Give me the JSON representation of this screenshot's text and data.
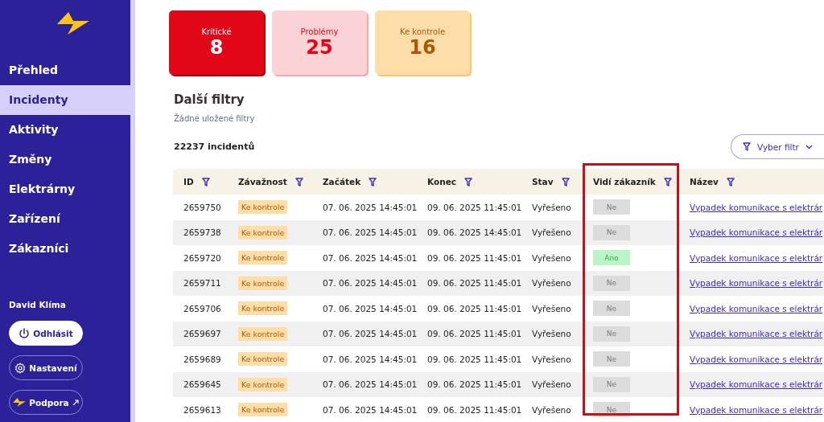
{
  "sidebar": {
    "items": [
      {
        "label": "Přehled",
        "selected": false
      },
      {
        "label": "Incidenty",
        "selected": true
      },
      {
        "label": "Aktivity",
        "selected": false
      },
      {
        "label": "Změny",
        "selected": false
      },
      {
        "label": "Elektrárny",
        "selected": false
      },
      {
        "label": "Zařízení",
        "selected": false
      },
      {
        "label": "Zákazníci",
        "selected": false
      }
    ],
    "user": "David Klíma",
    "buttons": [
      {
        "kind": "logout",
        "label": "Odhlásit"
      },
      {
        "kind": "settings",
        "label": "Nastavení"
      },
      {
        "kind": "support",
        "label": "Podpora"
      }
    ]
  },
  "summary_cards": [
    {
      "kind": "critical",
      "label": "Kritické",
      "count": "8"
    },
    {
      "kind": "problem",
      "label": "Problémy",
      "count": "25"
    },
    {
      "kind": "review",
      "label": "Ke kontrole",
      "count": "16"
    }
  ],
  "filters": {
    "title": "Další filtry",
    "empty_text": "Žádné uložené filtry",
    "select_button": "Vyber filtr"
  },
  "incident_count": "22237 incidentů",
  "table": {
    "columns": [
      {
        "label": "ID",
        "highlighted": false
      },
      {
        "label": "Závažnost",
        "highlighted": false
      },
      {
        "label": "Začátek",
        "highlighted": false
      },
      {
        "label": "Konec",
        "highlighted": false
      },
      {
        "label": "Stav",
        "highlighted": false
      },
      {
        "label": "Vidí zákazník",
        "highlighted": true
      },
      {
        "label": "Název",
        "highlighted": false
      }
    ],
    "rows": [
      {
        "id": "2659750",
        "severity": "Ke kontrole",
        "start": "07. 06. 2025 14:45:01",
        "end": "09. 06. 2025 11:45:01",
        "status": "Vyřešeno",
        "customer_visible": false,
        "visible_label": "Ne",
        "name": "Vypadek komunikace s elektrár"
      },
      {
        "id": "2659738",
        "severity": "Ke kontrole",
        "start": "07. 06. 2025 14:45:01",
        "end": "09. 06. 2025 14:45:01",
        "status": "Vyřešeno",
        "customer_visible": false,
        "visible_label": "Ne",
        "name": "Vypadek komunikace s elektrár"
      },
      {
        "id": "2659720",
        "severity": "Ke kontrole",
        "start": "07. 06. 2025 14:45:01",
        "end": "09. 06. 2025 11:45:01",
        "status": "Vyřešeno",
        "customer_visible": true,
        "visible_label": "Ano",
        "name": "Vypadek komunikace s elektrár"
      },
      {
        "id": "2659711",
        "severity": "Ke kontrole",
        "start": "07. 06. 2025 14:45:01",
        "end": "09. 06. 2025 11:45:01",
        "status": "Vyřešeno",
        "customer_visible": false,
        "visible_label": "Ne",
        "name": "Vypadek komunikace s elektrár"
      },
      {
        "id": "2659706",
        "severity": "Ke kontrole",
        "start": "07. 06. 2025 14:45:01",
        "end": "09. 06. 2025 11:45:01",
        "status": "Vyřešeno",
        "customer_visible": false,
        "visible_label": "Ne",
        "name": "Vypadek komunikace s elektrár"
      },
      {
        "id": "2659697",
        "severity": "Ke kontrole",
        "start": "07. 06. 2025 14:45:01",
        "end": "09. 06. 2025 11:45:01",
        "status": "Vyřešeno",
        "customer_visible": false,
        "visible_label": "Ne",
        "name": "Vypadek komunikace s elektrár"
      },
      {
        "id": "2659689",
        "severity": "Ke kontrole",
        "start": "07. 06. 2025 14:45:01",
        "end": "09. 06. 2025 11:45:01",
        "status": "Vyřešeno",
        "customer_visible": false,
        "visible_label": "Ne",
        "name": "Vypadek komunikace s elektrár"
      },
      {
        "id": "2659645",
        "severity": "Ke kontrole",
        "start": "07. 06. 2025 14:45:01",
        "end": "09. 06. 2025 11:45:01",
        "status": "Vyřešeno",
        "customer_visible": false,
        "visible_label": "Ne",
        "name": "Vypadek komunikace s elektrár"
      },
      {
        "id": "2659613",
        "severity": "Ke kontrole",
        "start": "07. 06. 2025 14:45:01",
        "end": "09. 06. 2025 11:45:01",
        "status": "Vyřešeno",
        "customer_visible": false,
        "visible_label": "Ne",
        "name": "Vypadek komunikace s elektrár"
      }
    ]
  }
}
